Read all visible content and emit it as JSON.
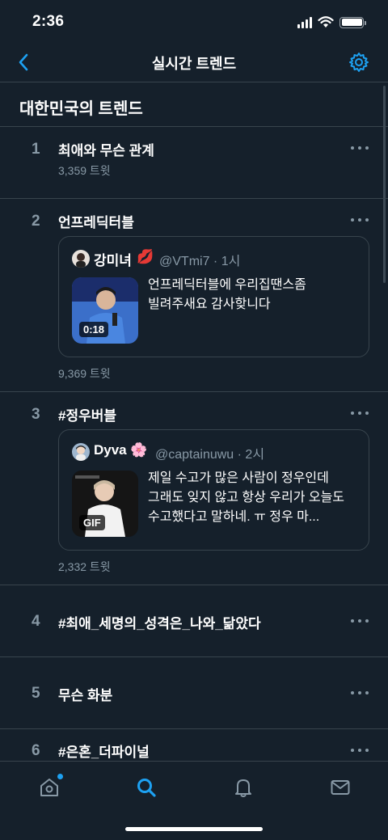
{
  "status_bar": {
    "time": "2:36"
  },
  "nav": {
    "title": "실시간 트렌드"
  },
  "section": {
    "title": "대한민국의 트렌드"
  },
  "trends": [
    {
      "rank": "1",
      "name": "최애와 무슨 관계",
      "count": "3,359 트윗"
    },
    {
      "rank": "2",
      "name": "언프레딕터블",
      "count": "9,369 트윗",
      "tweet": {
        "name": "강미녀",
        "emoji": "💋",
        "handle": "@VTmi7",
        "time": "· 1시",
        "text": "언프레딕터블에 우리집땐스좀 빌려주새요 감사핮니다",
        "media_badge": "0:18"
      }
    },
    {
      "rank": "3",
      "name": "#정우버블",
      "count": "2,332 트윗",
      "tweet": {
        "name": "Dyva",
        "emoji": "🌸",
        "handle": "@captainuwu",
        "time": "· 2시",
        "text": "제일 수고가 많은 사람이 정우인데 그래도 잊지 않고 항상 우리가 오늘도 수고했다고 말하네. ㅠ 정우 마...",
        "media_badge": "GIF"
      }
    },
    {
      "rank": "4",
      "name": "#최애_세명의_성격은_나와_닮았다"
    },
    {
      "rank": "5",
      "name": "무슨 화분"
    },
    {
      "rank": "6",
      "name": "#은혼_더파이널"
    }
  ],
  "colors": {
    "background": "#15202b",
    "accent": "#1da1f2",
    "divider": "#38444d",
    "secondary_text": "#8899a6"
  },
  "tabs": [
    {
      "icon": "home-icon",
      "active": false,
      "has_notification": true
    },
    {
      "icon": "search-icon",
      "active": true
    },
    {
      "icon": "bell-icon",
      "active": false
    },
    {
      "icon": "mail-icon",
      "active": false
    }
  ]
}
